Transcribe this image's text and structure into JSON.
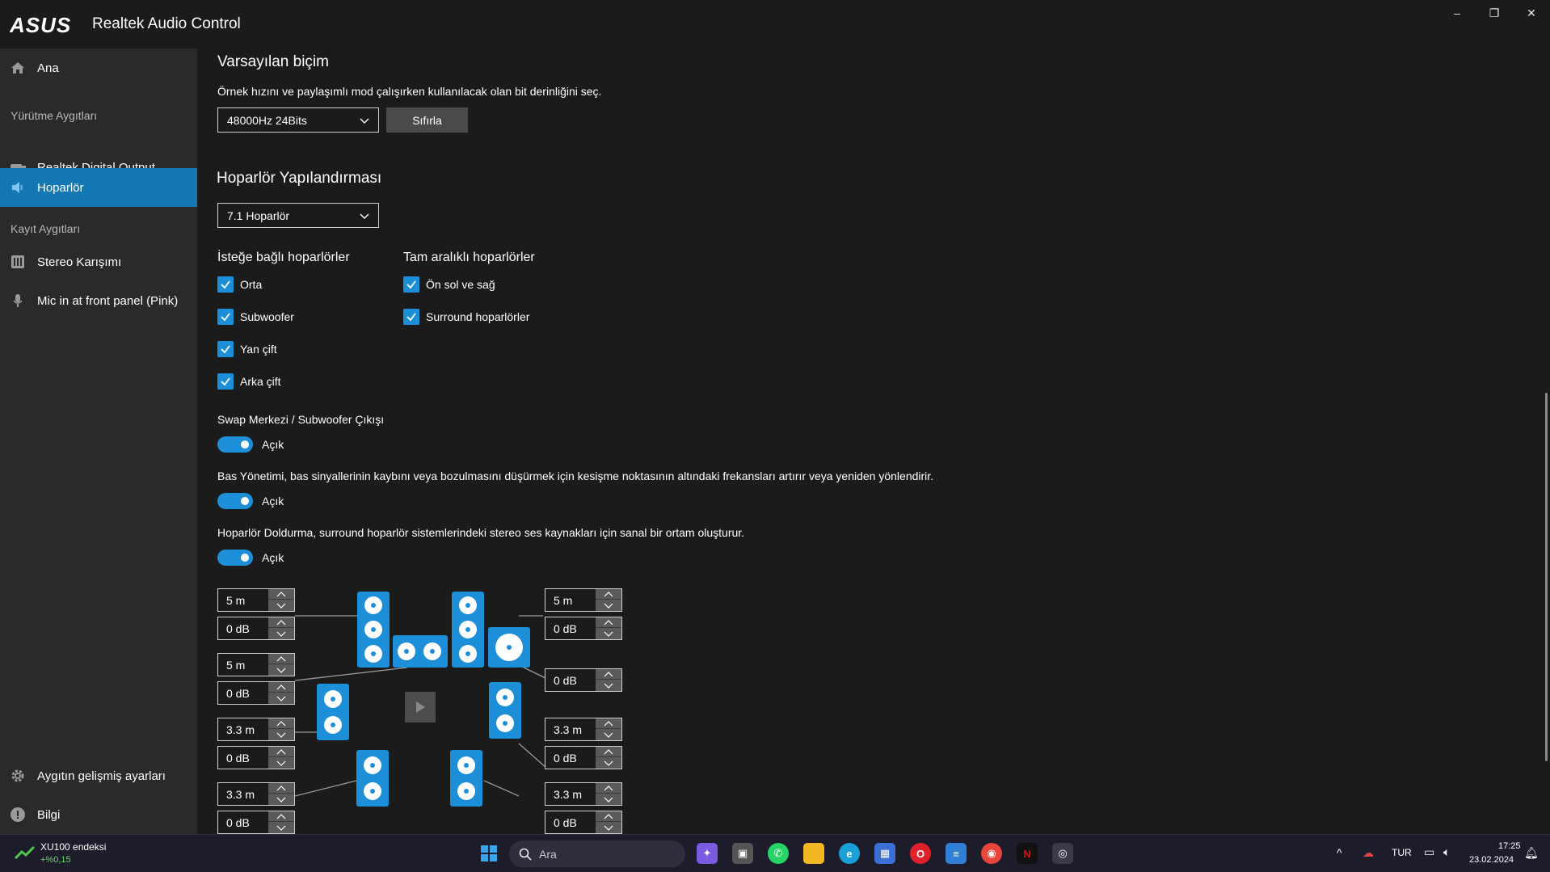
{
  "window": {
    "title": "Realtek Audio Control",
    "controls": {
      "minimize": "–",
      "maximize": "❐",
      "close": "✕"
    }
  },
  "sidebar": {
    "home": "Ana",
    "playback_header": "Yürütme Aygıtları",
    "playback_items": [
      "Realtek Digital Output",
      "Hoparlör"
    ],
    "recording_header": "Kayıt Aygıtları",
    "recording_items": [
      "Stereo Karışımı",
      "Mic in at front panel (Pink)"
    ],
    "advanced": "Aygıtın gelişmiş ayarları",
    "info": "Bilgi"
  },
  "main": {
    "default_format": {
      "title": "Varsayılan biçim",
      "description": "Örnek hızını ve paylaşımlı mod çalışırken kullanılacak olan bit derinliğini seç.",
      "selected": "48000Hz 24Bits",
      "reset_label": "Sıfırla"
    },
    "speaker_config": {
      "title": "Hoparlör Yapılandırması",
      "selected": "7.1 Hoparlör",
      "optional_header": "İsteğe bağlı hoparlörler",
      "optional": [
        "Orta",
        "Subwoofer",
        "Yan çift",
        "Arka çift"
      ],
      "fullrange_header": "Tam aralıklı hoparlörler",
      "fullrange": [
        "Ön sol ve sağ",
        "Surround hoparlörler"
      ]
    },
    "swap": {
      "label": "Swap Merkezi / Subwoofer Çıkışı",
      "state": "Açık"
    },
    "bass": {
      "label": "Bas Yönetimi, bas sinyallerinin kaybını veya bozulmasını düşürmek için kesişme noktasının altındaki frekansları artırır veya yeniden yönlendirir.",
      "state": "Açık"
    },
    "fill": {
      "label": "Hoparlör Doldurma, surround hoparlör sistemlerindeki stereo ses kaynakları için sanal bir ortam oluşturur.",
      "state": "Açık"
    },
    "spinners": {
      "left": [
        "5 m",
        "0 dB",
        "5 m",
        "0 dB",
        "3.3 m",
        "0 dB",
        "3.3 m",
        "0 dB"
      ],
      "right": [
        "5 m",
        "0 dB",
        "0 dB",
        "3.3 m",
        "0 dB",
        "3.3 m",
        "0 dB"
      ]
    }
  },
  "taskbar": {
    "widget_title": "XU100 endeksi",
    "widget_value": "+%0,15",
    "search_placeholder": "Ara",
    "language": "TUR",
    "time": "17:25",
    "date": "23.02.2024"
  },
  "colors": {
    "accent": "#1d8fd8",
    "sidebar_active": "#1478b4",
    "background": "#1b1b1b",
    "sidebar": "#2a2a2a"
  }
}
